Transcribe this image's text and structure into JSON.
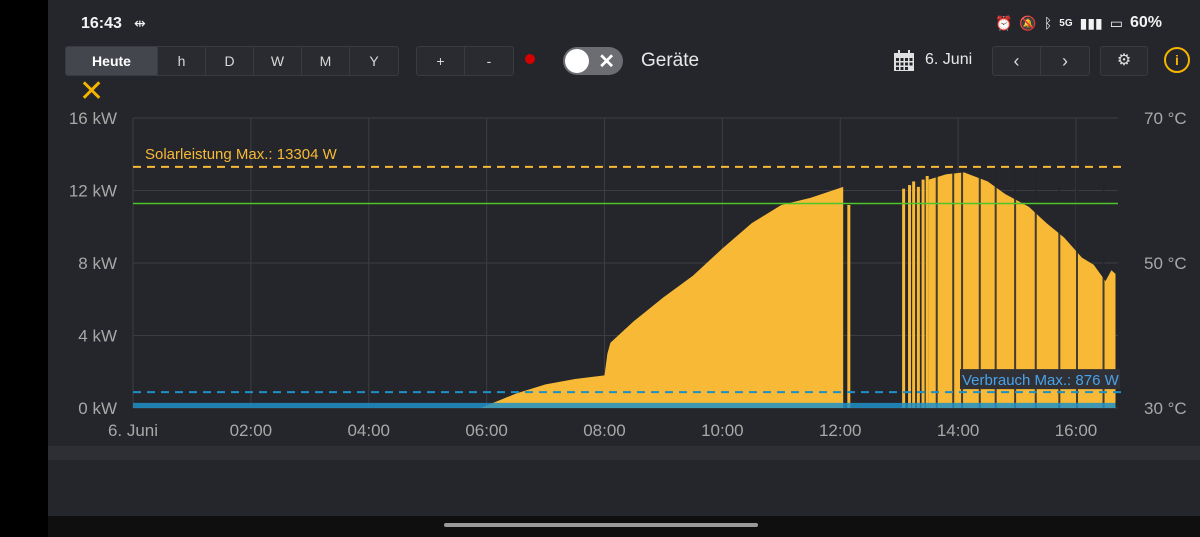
{
  "status": {
    "time": "16:43",
    "network": "5G",
    "battery": "60%"
  },
  "toolbar": {
    "periods": [
      "Heute",
      "h",
      "D",
      "W",
      "M",
      "Y"
    ],
    "active_period": "Heute",
    "zoom_in": "+",
    "zoom_out": "-",
    "devices_label": "Geräte",
    "date": "6. Juni",
    "prev": "‹",
    "next": "›"
  },
  "colors": {
    "solar": "#f7b936",
    "consumption": "#1e90c8",
    "temperature": "#4cc62b",
    "recording": "#d50000"
  },
  "chart_data": {
    "type": "area",
    "x_ticks": [
      "6. Juni",
      "02:00",
      "04:00",
      "06:00",
      "08:00",
      "10:00",
      "12:00",
      "14:00",
      "16:00"
    ],
    "y_left_ticks": [
      "0 kW",
      "4 kW",
      "8 kW",
      "12 kW",
      "16 kW"
    ],
    "y_right_ticks": [
      "30 °C",
      "50 °C",
      "70 °C"
    ],
    "ylim_kw": [
      0,
      16
    ],
    "ylim_temp": [
      30,
      70
    ],
    "annotations": {
      "solar_max": {
        "label": "Solarleistung Max.: 13304 W",
        "value_kw": 13.304
      },
      "consumption_max": {
        "label": "Verbrauch Max.: 876 W",
        "value_kw": 0.876
      }
    },
    "temperature_line_c": 58.2,
    "solar_series": {
      "hours": [
        0,
        5.9,
        6.5,
        7.0,
        7.5,
        8.0,
        8.05,
        8.1,
        8.5,
        9.0,
        9.5,
        10.0,
        10.5,
        11.0,
        11.5,
        12.05
      ],
      "kw": [
        0,
        0,
        0.8,
        1.3,
        1.6,
        1.8,
        3.0,
        3.6,
        4.8,
        6.1,
        7.3,
        8.8,
        10.2,
        11.2,
        11.6,
        12.2
      ]
    },
    "solar_afternoon": {
      "hours": [
        13.5,
        13.8,
        14.1,
        14.5,
        14.8,
        15.2,
        15.5,
        15.8,
        16.1,
        16.3,
        16.5,
        16.6,
        16.67
      ],
      "kw": [
        12.6,
        12.9,
        13.0,
        12.5,
        11.8,
        11.1,
        10.2,
        9.4,
        8.3,
        7.9,
        7.0,
        7.6,
        7.4
      ]
    },
    "consumption_kw_avg": 0.28
  }
}
